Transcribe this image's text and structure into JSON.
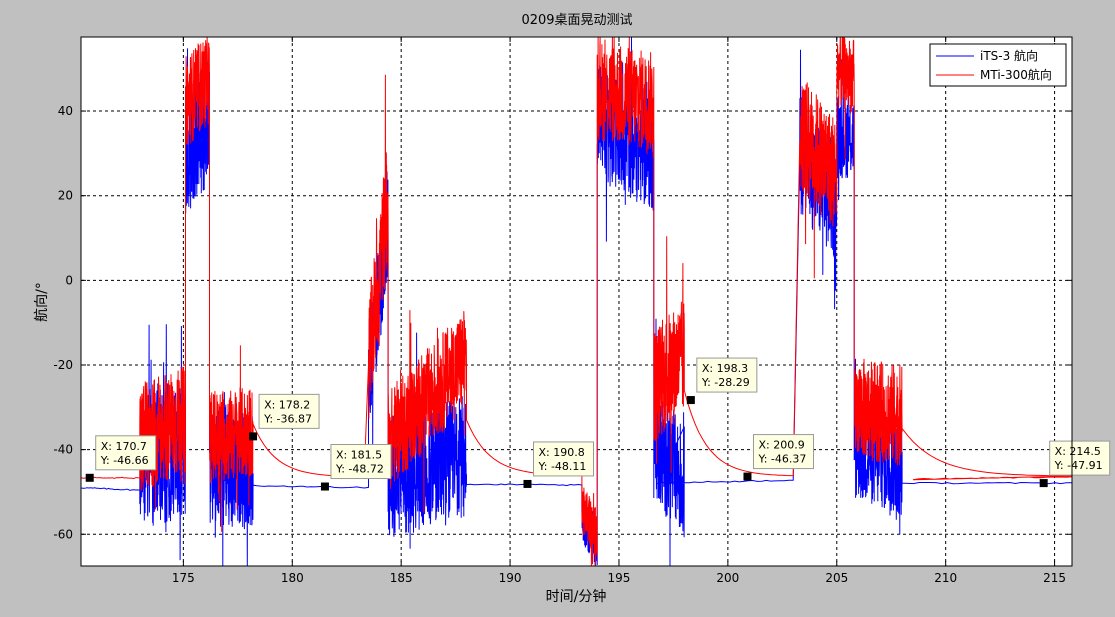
{
  "chart_data": {
    "type": "line",
    "title": "0209桌面晃动测试",
    "xlabel": "时间/分钟",
    "ylabel": "航向/°",
    "xlim": [
      170.3,
      215.8
    ],
    "ylim": [
      -67.5,
      57.5
    ],
    "xticks": [
      175,
      180,
      185,
      190,
      195,
      200,
      205,
      210,
      215
    ],
    "yticks": [
      -60,
      -40,
      -20,
      0,
      20,
      40
    ],
    "grid": true,
    "legend_position": "top-right",
    "colors": {
      "iTS-3 航向": "#0000ff",
      "MTi-300航向": "#ff0000",
      "background": "#c0c0c0",
      "axes": "#ffffff"
    },
    "series": [
      {
        "name": "iTS-3 航向",
        "color": "#0000ff",
        "baseline_segments": [
          {
            "x": [
              170.3,
              173.0
            ],
            "y": [
              -49.0,
              -49.6
            ]
          },
          {
            "x": [
              178.2,
              183.5
            ],
            "y": [
              -48.5,
              -49.0
            ]
          },
          {
            "x": [
              188.0,
              193.3
            ],
            "y": [
              -48.2,
              -48.4
            ]
          },
          {
            "x": [
              196.8,
              203.0
            ],
            "y": [
              -47.9,
              -47.2
            ]
          },
          {
            "x": [
              208.0,
              215.8
            ],
            "y": [
              -47.9,
              -47.9
            ]
          }
        ],
        "active_segments": [
          {
            "x": [
              173.0,
              175.1
            ],
            "mean": [
              -43,
              -40
            ],
            "amp": 16
          },
          {
            "x": [
              175.1,
              176.2
            ],
            "mean": [
              30,
              38
            ],
            "amp": 15
          },
          {
            "x": [
              176.2,
              178.2
            ],
            "mean": [
              -44,
              -45
            ],
            "amp": 14
          },
          {
            "x": [
              183.5,
              184.4
            ],
            "mean": [
              -22,
              14
            ],
            "amp": 14
          },
          {
            "x": [
              184.4,
              188.0
            ],
            "mean": [
              -46,
              -42
            ],
            "amp": 15
          },
          {
            "x": [
              193.3,
              194.0
            ],
            "mean": [
              -56,
              -62
            ],
            "amp": 6
          },
          {
            "x": [
              194.0,
              196.6
            ],
            "mean": [
              38,
              30
            ],
            "amp": 14
          },
          {
            "x": [
              196.6,
              198.0
            ],
            "mean": [
              -38,
              -48
            ],
            "amp": 14
          },
          {
            "x": [
              203.3,
              205.0
            ],
            "mean": [
              30,
              18
            ],
            "amp": 14
          },
          {
            "x": [
              205.0,
              205.8
            ],
            "mean": [
              34,
              34
            ],
            "amp": 10
          },
          {
            "x": [
              205.8,
              208.0
            ],
            "mean": [
              -40,
              -44
            ],
            "amp": 12
          }
        ]
      },
      {
        "name": "MTi-300航向",
        "color": "#ff0000",
        "baseline_segments": [
          {
            "x": [
              170.3,
              173.0
            ],
            "y": [
              -46.66,
              -46.7
            ]
          },
          {
            "x": [
              208.5,
              215.8
            ],
            "y": [
              -47.0,
              -46.4
            ]
          }
        ],
        "decay_segments": [
          {
            "x": [
              178.2,
              183.3
            ],
            "from": -34.0,
            "to": -46.5
          },
          {
            "x": [
              188.0,
              193.3
            ],
            "from": -33.0,
            "to": -46.2
          },
          {
            "x": [
              198.0,
              203.0
            ],
            "from": -26.0,
            "to": -46.3
          },
          {
            "x": [
              208.0,
              215.8
            ],
            "from": -35.0,
            "to": -46.3
          }
        ],
        "active_segments": [
          {
            "x": [
              173.0,
              175.1
            ],
            "mean": [
              -37,
              -33
            ],
            "amp": 13
          },
          {
            "x": [
              175.1,
              176.2
            ],
            "mean": [
              42,
              48
            ],
            "amp": 11
          },
          {
            "x": [
              176.2,
              178.2
            ],
            "mean": [
              -37,
              -36
            ],
            "amp": 11
          },
          {
            "x": [
              183.5,
              184.4
            ],
            "mean": [
              -20,
              20
            ],
            "amp": 15
          },
          {
            "x": [
              184.4,
              188.0
            ],
            "mean": [
              -38,
              -18
            ],
            "amp": 12
          },
          {
            "x": [
              193.3,
              194.0
            ],
            "mean": [
              -54,
              -60
            ],
            "amp": 6
          },
          {
            "x": [
              194.0,
              196.6
            ],
            "mean": [
              45,
              42
            ],
            "amp": 12
          },
          {
            "x": [
              196.6,
              198.0
            ],
            "mean": [
              -25,
              -18
            ],
            "amp": 14
          },
          {
            "x": [
              203.3,
              205.0
            ],
            "mean": [
              35,
              25
            ],
            "amp": 14
          },
          {
            "x": [
              205.0,
              205.8
            ],
            "mean": [
              50,
              48
            ],
            "amp": 9
          },
          {
            "x": [
              205.8,
              208.0
            ],
            "mean": [
              -30,
              -32
            ],
            "amp": 12
          }
        ]
      }
    ],
    "annotations": [
      {
        "x": 170.7,
        "y": -46.66,
        "text_x": "X: 170.7",
        "text_y": "Y: -46.66"
      },
      {
        "x": 178.2,
        "y": -36.87,
        "text_x": "X: 178.2",
        "text_y": "Y: -36.87"
      },
      {
        "x": 181.5,
        "y": -48.72,
        "text_x": "X: 181.5",
        "text_y": "Y: -48.72"
      },
      {
        "x": 190.8,
        "y": -48.11,
        "text_x": "X: 190.8",
        "text_y": "Y: -48.11"
      },
      {
        "x": 198.3,
        "y": -28.29,
        "text_x": "X: 198.3",
        "text_y": "Y: -28.29"
      },
      {
        "x": 200.9,
        "y": -46.37,
        "text_x": "X: 200.9",
        "text_y": "Y: -46.37"
      },
      {
        "x": 214.5,
        "y": -47.91,
        "text_x": "X: 214.5",
        "text_y": "Y: -47.91"
      }
    ]
  }
}
